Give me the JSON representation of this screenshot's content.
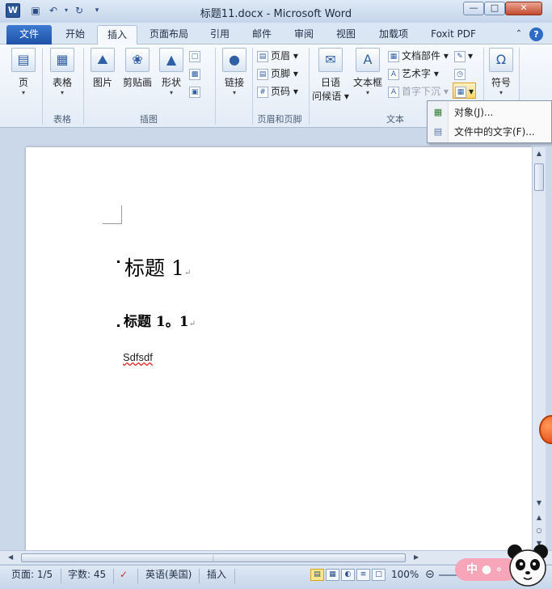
{
  "titlebar": {
    "logo_letter": "W",
    "title": "标题11.docx - Microsoft Word",
    "help": "?"
  },
  "tabs": [
    "文件",
    "开始",
    "插入",
    "页面布局",
    "引用",
    "邮件",
    "审阅",
    "视图",
    "加载项",
    "Foxit PDF"
  ],
  "ribbon": {
    "groups": {
      "pages": "页",
      "tables": "表格",
      "illustrations": "插图",
      "links": "链接",
      "header_footer": "页眉和页脚",
      "text": "文本",
      "symbols": "符号"
    },
    "buttons": {
      "page": "页",
      "table": "表格",
      "picture": "图片",
      "clipart": "剪贴画",
      "shapes": "形状",
      "link": "链接",
      "header": "页眉",
      "footer": "页脚",
      "page_number": "页码",
      "greeting_line1": "日语",
      "greeting_line2": "问候语",
      "textbox": "文本框",
      "quick_parts": "文档部件",
      "wordart": "艺术字",
      "dropcap": "首字下沉",
      "symbol": "符号"
    }
  },
  "object_menu": {
    "items": [
      {
        "label": "对象(J)..."
      },
      {
        "label": "文件中的文字(F)..."
      }
    ]
  },
  "document": {
    "heading1": "标题 1",
    "heading2": "标题 1。1",
    "body_text": "Sdfsdf"
  },
  "statusbar": {
    "page": "页面: 1/5",
    "words": "字数: 45",
    "language": "英语(美国)",
    "mode": "插入",
    "zoom": "100%"
  },
  "ime": {
    "label": "中"
  }
}
